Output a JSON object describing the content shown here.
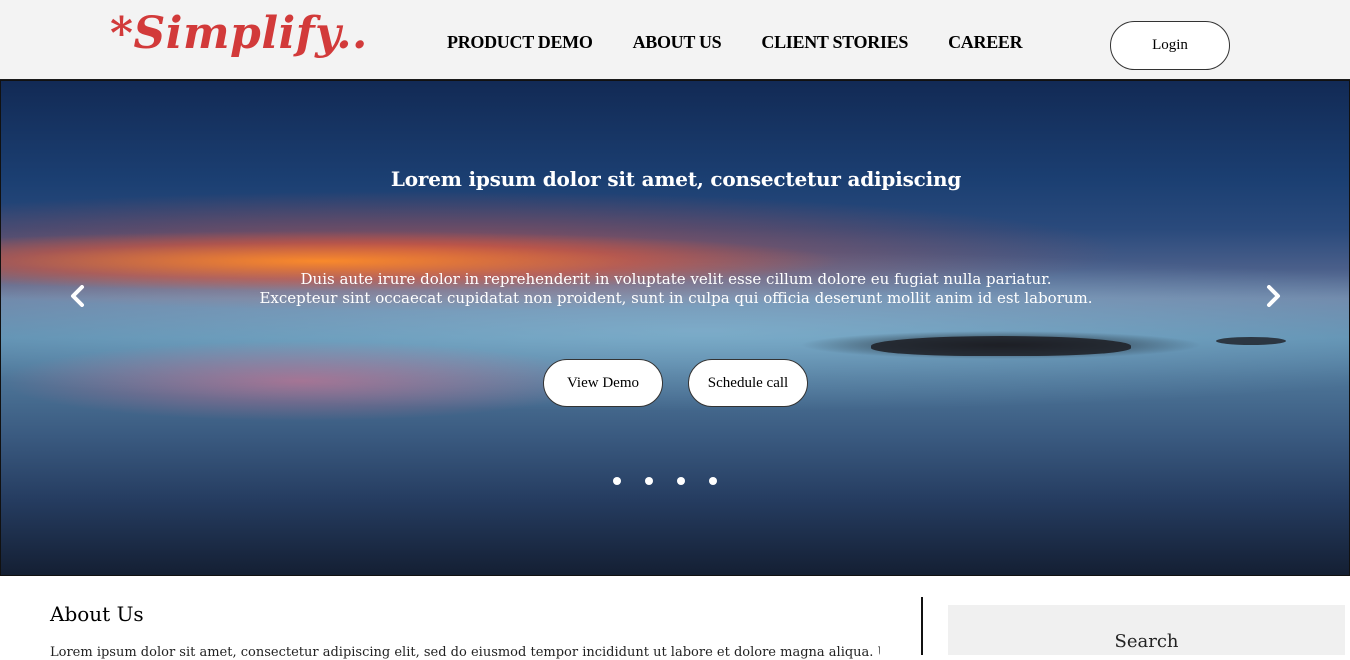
{
  "header": {
    "logo": "*Simplify..",
    "nav": [
      "PRODUCT DEMO",
      "ABOUT US",
      "CLIENT STORIES",
      "CAREER"
    ],
    "login_label": "Login"
  },
  "hero": {
    "title": "Lorem ipsum dolor sit amet, consectetur adipiscing",
    "text_line1": "Duis aute irure dolor in reprehenderit in voluptate velit esse cillum dolore eu fugiat nulla pariatur.",
    "text_line2": "Excepteur sint occaecat cupidatat non proident, sunt in culpa qui officia deserunt mollit anim id est laborum.",
    "buttons": {
      "demo": "View Demo",
      "call": "Schedule call"
    },
    "icons": {
      "prev": "chevron-left-icon",
      "next": "chevron-right-icon"
    },
    "slides_count": 4,
    "colors": {
      "logo": "#d23a3a",
      "text": "#ffffff"
    }
  },
  "content": {
    "about_title": "About Us",
    "about_text": "Lorem ipsum dolor sit amet, consectetur adipiscing elit, sed do eiusmod tempor incididunt ut labore et dolore magna aliqua. Ut enim ad",
    "sidebar_title": "Search"
  }
}
